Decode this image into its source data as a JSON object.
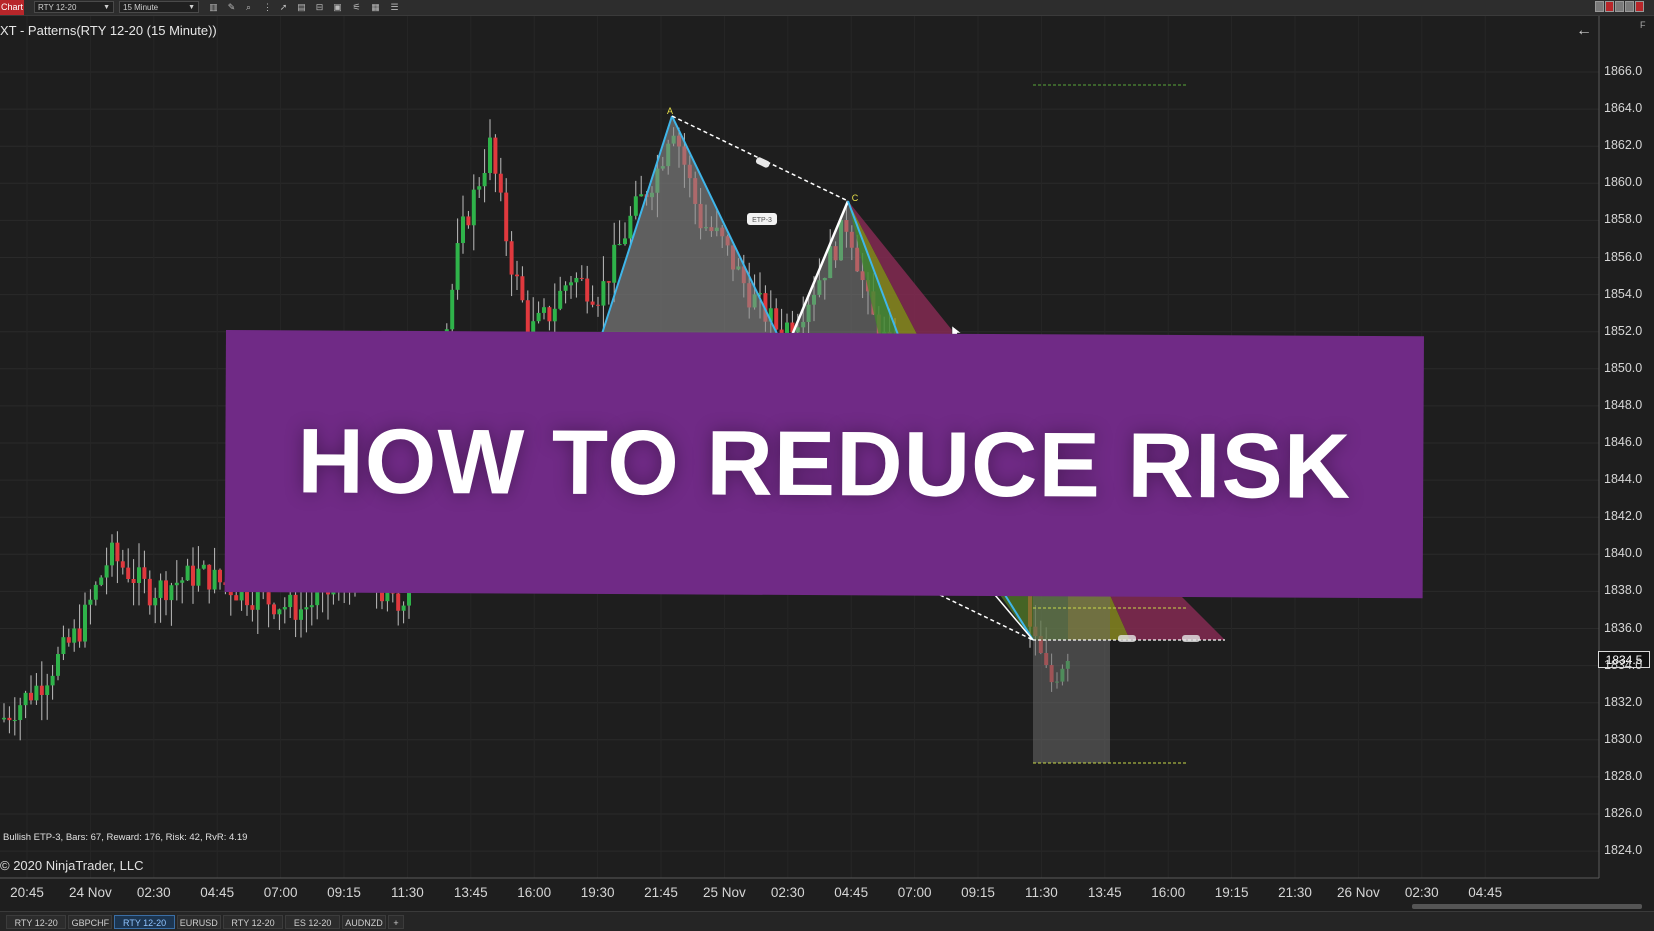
{
  "window": {
    "chart_tab": "Chart",
    "instrument_select": "RTY 12-20",
    "interval_select": "15 Minute"
  },
  "toolbar_icons": [
    "bar-type-icon",
    "draw-tool-icon",
    "zoom-icon",
    "arrow-pointer-icon",
    "data-box-icon",
    "templates-icon",
    "properties-icon",
    "strategies-icon",
    "indicators-icon",
    "list-icon"
  ],
  "chart": {
    "title": "XT - Patterns(RTY 12-20 (15 Minute))",
    "status_line": "Bullish ETP-3, Bars: 67, Reward: 176, Risk: 42, RvR: 4.19",
    "copyright": "© 2020 NinjaTrader, LLC",
    "current_price": "1834.5",
    "corner_label": "F",
    "pattern_labels": {
      "a": "A",
      "c": "C",
      "etp": "ETP-3"
    },
    "y_axis_labels": [
      "1866.0",
      "1864.0",
      "1862.0",
      "1860.0",
      "1858.0",
      "1856.0",
      "1854.0",
      "1852.0",
      "1850.0",
      "1848.0",
      "1846.0",
      "1844.0",
      "1842.0",
      "1840.0",
      "1838.0",
      "1836.0",
      "1834.0",
      "1832.0",
      "1830.0",
      "1828.0",
      "1826.0",
      "1824.0"
    ],
    "x_axis_labels": [
      "20:45",
      "24 Nov",
      "02:30",
      "04:45",
      "07:00",
      "09:15",
      "11:30",
      "13:45",
      "16:00",
      "19:30",
      "21:45",
      "25 Nov",
      "02:30",
      "04:45",
      "07:00",
      "09:15",
      "11:30",
      "13:45",
      "16:00",
      "19:15",
      "21:30",
      "26 Nov",
      "02:30",
      "04:45"
    ],
    "colors": {
      "background": "#1e1e1e",
      "up_candle": "#2fb34a",
      "down_candle": "#e0393e",
      "pattern_line": "#2fa8e0",
      "banner": "#702a86"
    }
  },
  "chart_data": {
    "type": "candlestick",
    "instrument": "RTY 12-20",
    "interval": "15 Minute",
    "ylim": [
      1823,
      1867.5
    ],
    "current_price": 1834.5,
    "pattern": {
      "name": "Bullish ETP-3",
      "bars": 67,
      "reward": 176,
      "risk": 42,
      "rvr": 4.19
    }
  },
  "banner": {
    "text": "HOW TO REDUCE RISK"
  },
  "bottom_tabs": [
    {
      "label": "RTY 12-20",
      "active": false
    },
    {
      "label": "GBPCHF",
      "active": false
    },
    {
      "label": "RTY 12-20",
      "active": true
    },
    {
      "label": "EURUSD",
      "active": false
    },
    {
      "label": "RTY 12-20",
      "active": false
    },
    {
      "label": "ES 12-20",
      "active": false
    },
    {
      "label": "AUDNZD",
      "active": false
    }
  ],
  "add_tab_label": "+"
}
